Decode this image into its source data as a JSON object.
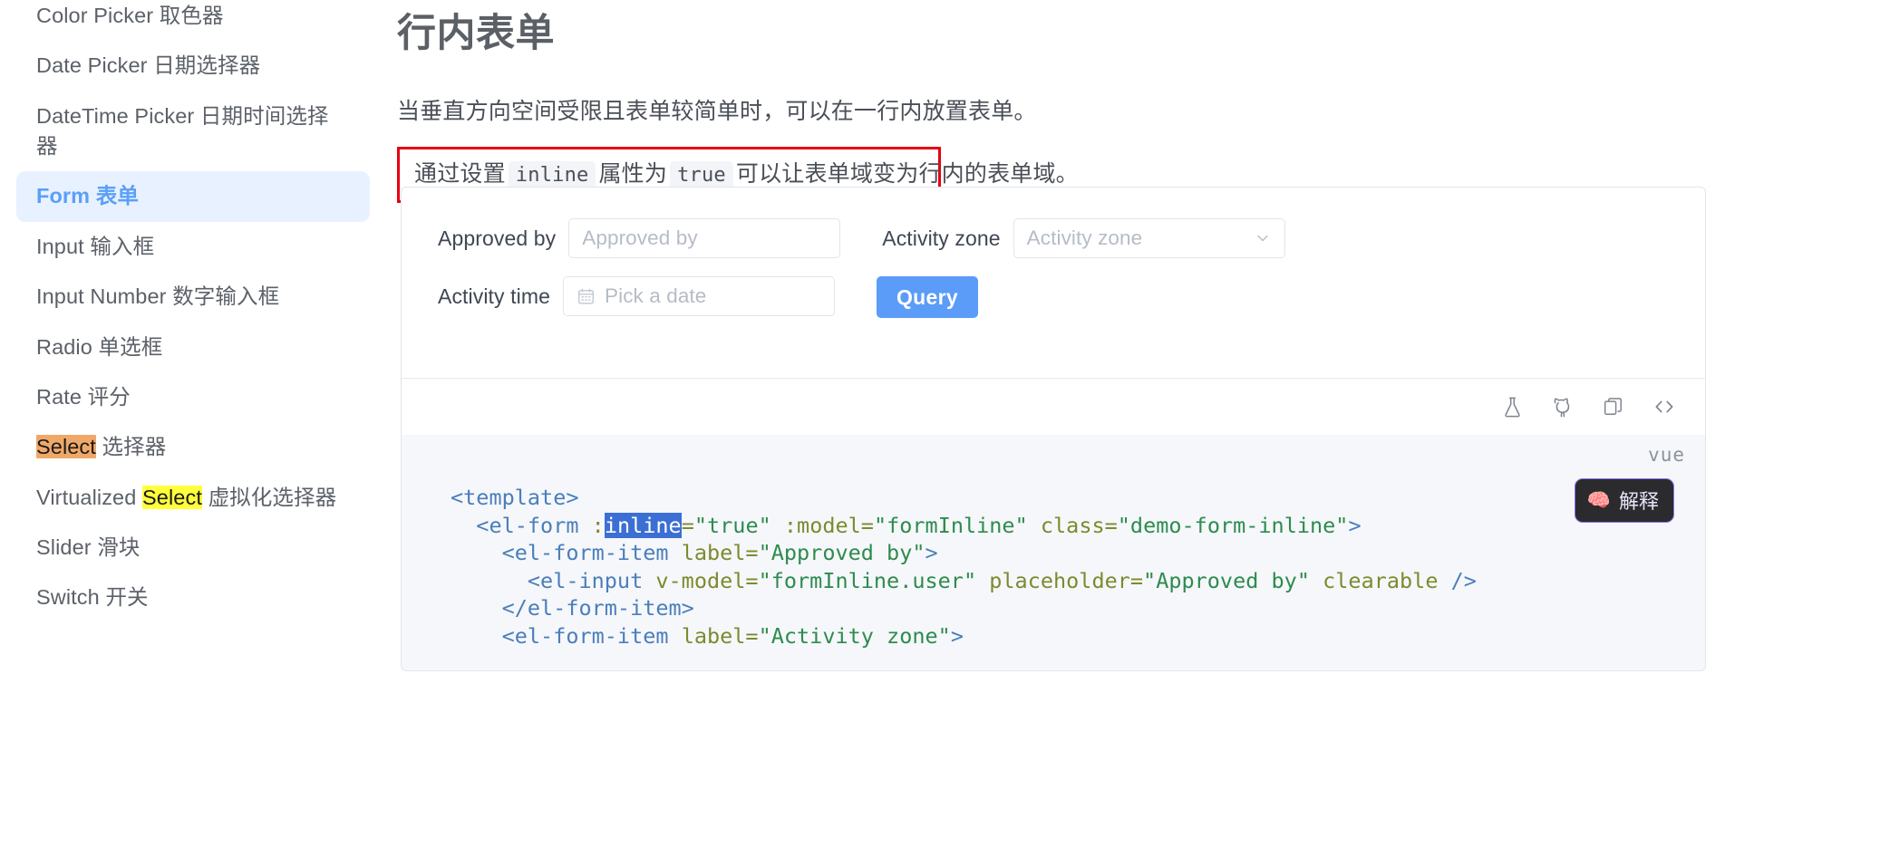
{
  "sidebar": {
    "items": [
      {
        "text": "Color Picker 取色器",
        "active": false,
        "clipped": true
      },
      {
        "text": "Date Picker 日期选择器",
        "active": false
      },
      {
        "text": "DateTime Picker 日期时间选择器",
        "active": false
      },
      {
        "text": "Form 表单",
        "active": true
      },
      {
        "text": "Input 输入框",
        "active": false
      },
      {
        "text": "Input Number 数字输入框",
        "active": false
      },
      {
        "text": "Radio 单选框",
        "active": false
      },
      {
        "text": "Rate 评分",
        "active": false
      },
      {
        "text": "Select 选择器",
        "active": false,
        "highlight": {
          "term": "Select",
          "kind": "current"
        }
      },
      {
        "text": "Virtualized Select 虚拟化选择器",
        "active": false,
        "highlight": {
          "term": "Select",
          "kind": "other"
        }
      },
      {
        "text": "Slider 滑块",
        "active": false
      },
      {
        "text": "Switch 开关",
        "active": false
      }
    ],
    "search_term": "Select",
    "highlight_current_color": "#f0a868",
    "highlight_other_color": "#ffff3c",
    "active_bg_color": "#e8f1ff",
    "active_text_color": "#5aa0f7"
  },
  "page": {
    "title": "行内表单",
    "intro": "当垂直方向空间受限且表单较简单时，可以在一行内放置表单。",
    "callout": {
      "prefix": "通过设置",
      "code1": "inline",
      "middle": "属性为",
      "code2": "true",
      "suffix": "可以让表单域变为行内的表单域。",
      "border_color": "#e60012"
    }
  },
  "demo": {
    "fields": [
      {
        "label": "Approved by",
        "placeholder": "Approved by",
        "type": "input"
      },
      {
        "label": "Activity zone",
        "placeholder": "Activity zone",
        "type": "select"
      },
      {
        "label": "Activity time",
        "placeholder": "Pick a date",
        "type": "date"
      }
    ],
    "query_label": "Query",
    "query_color": "#5a9cf8",
    "toolbar_icons": [
      {
        "name": "flask-icon",
        "title": "playground"
      },
      {
        "name": "github-icon",
        "title": "github"
      },
      {
        "name": "copy-icon",
        "title": "copy"
      },
      {
        "name": "code-icon",
        "title": "source"
      }
    ]
  },
  "code": {
    "language": "vue",
    "explain_label": "解释",
    "explain_icon": "🧠",
    "selection": "inline",
    "lines": [
      {
        "indent": 0,
        "parts": [
          {
            "t": "punc",
            "v": "<"
          },
          {
            "t": "tag",
            "v": "template"
          },
          {
            "t": "punc",
            "v": ">"
          }
        ]
      },
      {
        "indent": 1,
        "parts": [
          {
            "t": "punc",
            "v": "<"
          },
          {
            "t": "tag",
            "v": "el-form"
          },
          {
            "t": "plain",
            "v": " "
          },
          {
            "t": "attr",
            "v": ":"
          },
          {
            "t": "sel",
            "v": "inline"
          },
          {
            "t": "attr",
            "v": "="
          },
          {
            "t": "str",
            "v": "\"true\""
          },
          {
            "t": "plain",
            "v": " "
          },
          {
            "t": "attr",
            "v": ":model="
          },
          {
            "t": "str",
            "v": "\"formInline\""
          },
          {
            "t": "plain",
            "v": " "
          },
          {
            "t": "attr",
            "v": "class="
          },
          {
            "t": "str",
            "v": "\"demo-form-inline\""
          },
          {
            "t": "punc",
            "v": ">"
          }
        ]
      },
      {
        "indent": 2,
        "parts": [
          {
            "t": "punc",
            "v": "<"
          },
          {
            "t": "tag",
            "v": "el-form-item"
          },
          {
            "t": "plain",
            "v": " "
          },
          {
            "t": "attr",
            "v": "label="
          },
          {
            "t": "str",
            "v": "\"Approved by\""
          },
          {
            "t": "punc",
            "v": ">"
          }
        ]
      },
      {
        "indent": 3,
        "parts": [
          {
            "t": "punc",
            "v": "<"
          },
          {
            "t": "tag",
            "v": "el-input"
          },
          {
            "t": "plain",
            "v": " "
          },
          {
            "t": "attr",
            "v": "v-model="
          },
          {
            "t": "str",
            "v": "\"formInline.user\""
          },
          {
            "t": "plain",
            "v": " "
          },
          {
            "t": "attr",
            "v": "placeholder="
          },
          {
            "t": "str",
            "v": "\"Approved by\""
          },
          {
            "t": "plain",
            "v": " "
          },
          {
            "t": "attr",
            "v": "clearable"
          },
          {
            "t": "plain",
            "v": " "
          },
          {
            "t": "punc",
            "v": "/>"
          }
        ]
      },
      {
        "indent": 2,
        "parts": [
          {
            "t": "punc",
            "v": "</"
          },
          {
            "t": "tag",
            "v": "el-form-item"
          },
          {
            "t": "punc",
            "v": ">"
          }
        ]
      },
      {
        "indent": 2,
        "parts": [
          {
            "t": "punc",
            "v": "<"
          },
          {
            "t": "tag",
            "v": "el-form-item"
          },
          {
            "t": "plain",
            "v": " "
          },
          {
            "t": "attr",
            "v": "label="
          },
          {
            "t": "str",
            "v": "\"Activity zone\""
          },
          {
            "t": "punc",
            "v": ">"
          }
        ]
      }
    ]
  }
}
